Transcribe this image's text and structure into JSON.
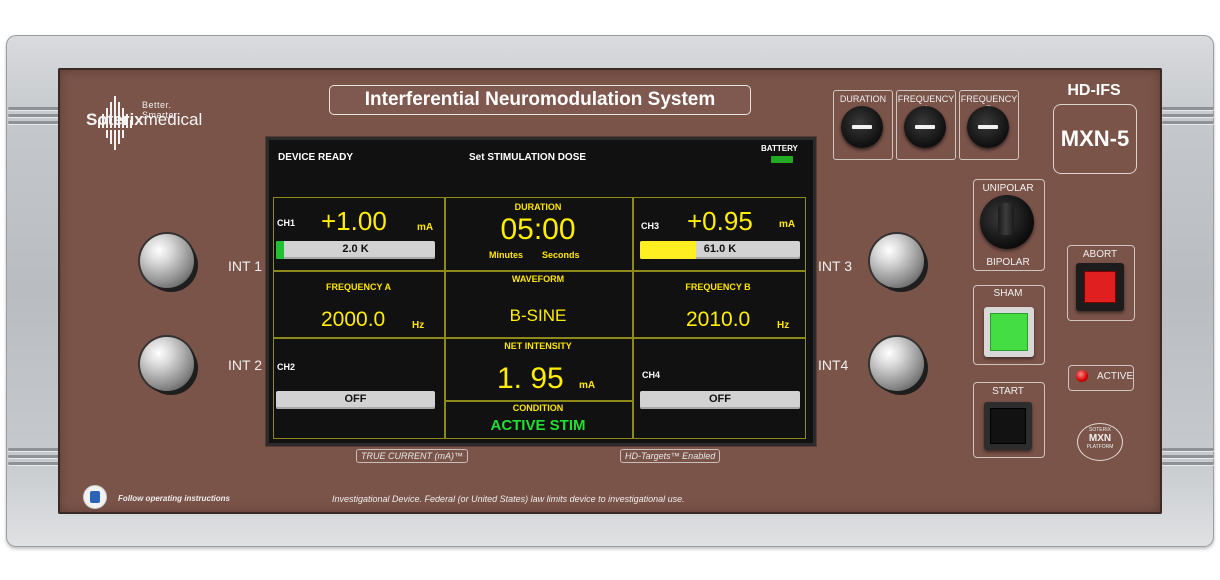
{
  "device": {
    "model_top": "HD-IFS",
    "model_badge": "MXN-5",
    "title": "Interferential Neuromodulation System",
    "brand_tagline": "Better. Smarter.",
    "brand_name_a": "Soterix",
    "brand_name_b": "medical"
  },
  "screen": {
    "status": "DEVICE READY",
    "header": "Set STIMULATION  DOSE",
    "battery_label": "BATTERY",
    "ch1": {
      "label": "CH1",
      "value": "+1.00",
      "unit": "mA",
      "impedance": "2.0 K",
      "fill_fraction": 0.05
    },
    "ch2": {
      "label": "CH2",
      "state": "OFF"
    },
    "ch3": {
      "label": "CH3",
      "value": "+0.95",
      "unit": "mA",
      "impedance": "61.0 K",
      "fill_fraction": 0.35
    },
    "ch4": {
      "label": "CH4",
      "state": "OFF"
    },
    "freq_a": {
      "label": "FREQUENCY A",
      "value": "2000.0",
      "unit": "Hz"
    },
    "freq_b": {
      "label": "FREQUENCY B",
      "value": "2010.0",
      "unit": "Hz"
    },
    "duration": {
      "label": "DURATION",
      "value": "05:00",
      "minutes": "Minutes",
      "seconds": "Seconds"
    },
    "waveform": {
      "label": "WAVEFORM",
      "value": "B-SINE"
    },
    "net": {
      "label": "NET INTENSITY",
      "value": "1. 95",
      "unit": "mA"
    },
    "condition": {
      "label": "CONDITION",
      "value": "ACTIVE STIM"
    }
  },
  "controls": {
    "knob_labels": [
      "DURATION",
      "FREQUENCY A",
      "FREQUENCY B"
    ],
    "int1": "INT 1",
    "int2": "INT 2",
    "int3": "INT 3",
    "int4": "INT4",
    "unipolar": "UNIPOLAR",
    "bipolar": "BIPOLAR",
    "sham": "SHAM",
    "start": "START",
    "abort": "ABORT",
    "active": "ACTIVE",
    "stamp_top": "SOTERIX",
    "stamp_mid": "MXN",
    "stamp_bot": "PLATFORM"
  },
  "footer": {
    "true_current": "TRUE CURRENT (mA)™",
    "hd_targets": "HD-Targets™ Enabled",
    "instructions": "Follow operating instructions",
    "disclaimer": "Investigational Device. Federal (or United States) law limits device to investigational use."
  },
  "colors": {
    "panel": "#7a5349",
    "screen_text_yellow": "#ffee00",
    "condition_green": "#22dd33",
    "ch1_fill": "#22c033",
    "ch3_fill": "#ffee22",
    "abort_red": "#e02020",
    "sham_green": "#44dd44",
    "battery_green": "#22aa22"
  }
}
